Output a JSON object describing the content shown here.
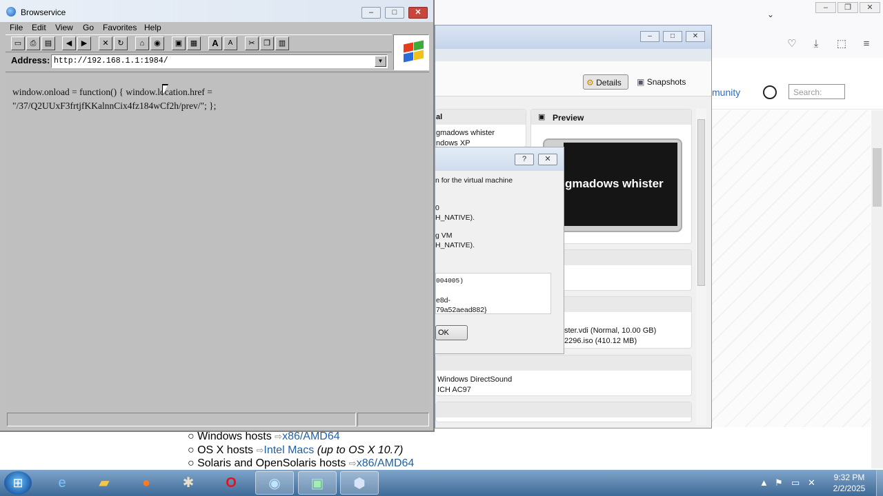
{
  "background_browser": {
    "nav_label": "munity",
    "search_placeholder": "Search:",
    "list": [
      {
        "text": "Windows hosts",
        "link": "x86/AMD64",
        "note": ""
      },
      {
        "text": "OS X hosts",
        "link": "Intel Macs",
        "note": "(up to OS X 10.7)"
      },
      {
        "text": "Solaris and OpenSolaris hosts",
        "link": "x86/AMD64",
        "note": ""
      }
    ]
  },
  "virtualbox": {
    "toolbar": {
      "details": "Details",
      "snapshots": "Snapshots"
    },
    "general_header": "al",
    "general_name": "gmadows whister",
    "general_os": "ndows XP",
    "preview_header": "Preview",
    "preview_text": "gmadows whister",
    "storage_line1": "ster.vdi (Normal, 10.00 GB)",
    "storage_line2": "2296.iso (410.12 MB)",
    "audio_line1": "Windows DirectSound",
    "audio_line2": "ICH AC97"
  },
  "about_dialog": {
    "help_button": "?",
    "close_button": "✕",
    "line1": "n for the virtual machine",
    "line2": "0",
    "line3": "H_NATIVE).",
    "line4": "g VM",
    "line5": "H_NATIVE).",
    "info_line1": "004005)",
    "info_line2": "e8d-",
    "info_line3": "79a52aead882}",
    "ok": "OK"
  },
  "browservice": {
    "title": "Browservice",
    "menu": [
      "File",
      "Edit",
      "View",
      "Go",
      "Favorites",
      "Help"
    ],
    "address_label": "Address:",
    "address_value": "http://192.168.1.1:1984/",
    "code": "window.onload = function() { window.location.href = \"/37/Q2UUxF3frtjfKKalnnCix4fz184wCf2h/prev/\"; };"
  },
  "taskbar": {
    "time": "9:32 PM",
    "date": "2/2/2025"
  },
  "colors": {
    "win98_gray": "#c0c0c0",
    "taskbar_blue": "#3e6a97",
    "link_blue": "#1f5fa6"
  }
}
